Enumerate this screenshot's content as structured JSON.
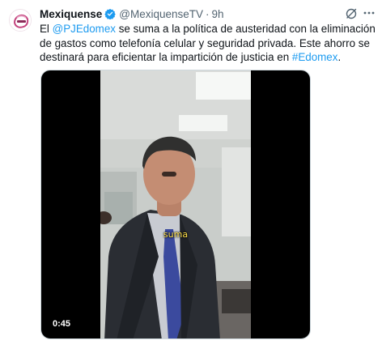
{
  "tweet": {
    "display_name": "Mexiquense",
    "handle": "@MexiquenseTV",
    "separator": "·",
    "time": "9h",
    "text_parts": {
      "p1": "El ",
      "mention": "@PJEdomex",
      "p2": " se suma a la política de austeridad con la eliminación de gastos como telefonía celular y seguridad privada. Este ahorro se destinará para eficientar la impartición de justicia en ",
      "hashtag": "#Edomex",
      "p3": "."
    }
  },
  "video": {
    "caption": "suma",
    "duration": "0:45"
  },
  "colors": {
    "link": "#1d9bf0",
    "verified": "#1d9bf0",
    "caption": "#ffe04b"
  },
  "icons": {
    "verified": "verified-badge-icon",
    "grok": "grok-icon",
    "more": "more-icon",
    "avatar": "channel-logo"
  }
}
